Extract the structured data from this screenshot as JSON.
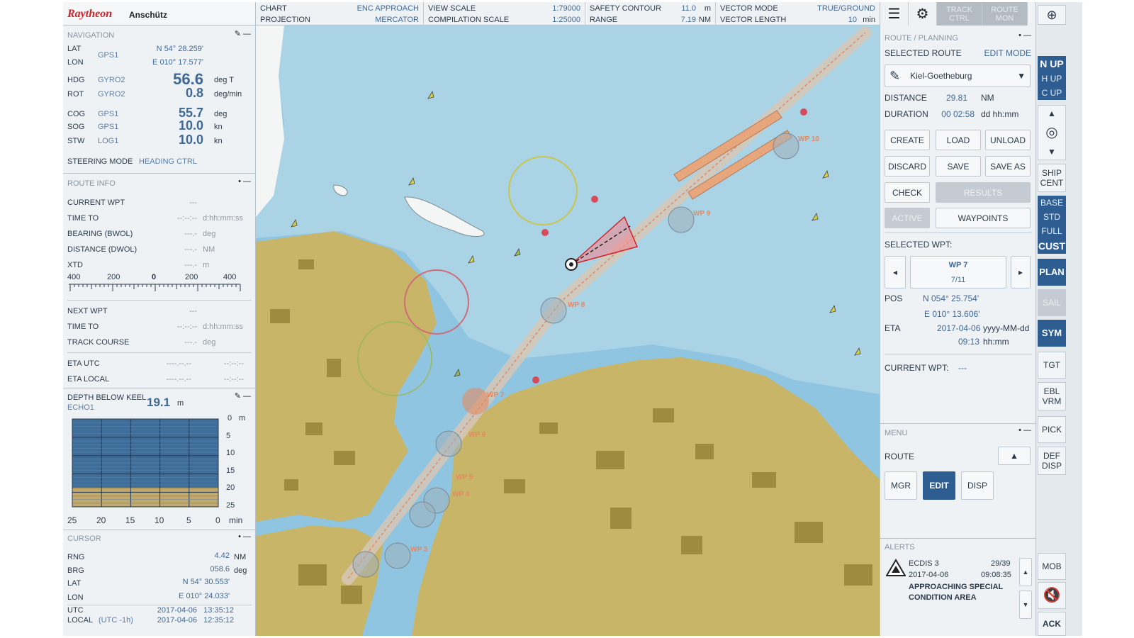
{
  "brand": {
    "name": "Raytheon",
    "sub": "Anschütz"
  },
  "top": {
    "chart_label": "CHART",
    "chart_value": "ENC APPROACH",
    "projection_label": "PROJECTION",
    "projection_value": "MERCATOR",
    "view_scale_label": "VIEW SCALE",
    "view_scale_value": "1:79000",
    "compilation_label": "COMPILATION SCALE",
    "compilation_value": "1:25000",
    "safety_label": "SAFETY CONTOUR",
    "safety_value": "11.0",
    "safety_unit": "m",
    "range_label": "RANGE",
    "range_value": "7.19",
    "range_unit": "NM",
    "vector_mode_label": "VECTOR MODE",
    "vector_mode_value": "TRUE/GROUND",
    "vector_length_label": "VECTOR LENGTH",
    "vector_length_value": "10",
    "vector_length_unit": "min"
  },
  "nav": {
    "title": "NAVIGATION",
    "lat_label": "LAT",
    "lon_label": "LON",
    "pos_src": "GPS1",
    "lat": "N 54° 28.259'",
    "lon": "E 010° 17.577'",
    "hdg_label": "HDG",
    "hdg_src": "GYRO2",
    "hdg": "56.6",
    "hdg_unit": "deg T",
    "rot_label": "ROT",
    "rot_src": "GYRO2",
    "rot": "0.8",
    "rot_unit": "deg/min",
    "cog_label": "COG",
    "cog_src": "GPS1",
    "cog": "55.7",
    "cog_unit": "deg",
    "sog_label": "SOG",
    "sog_src": "GPS1",
    "sog": "10.0",
    "sog_unit": "kn",
    "stw_label": "STW",
    "stw_src": "LOG1",
    "stw": "10.0",
    "stw_unit": "kn",
    "steer_label": "STEERING MODE",
    "steer_value": "HEADING CTRL"
  },
  "route_info": {
    "title": "ROUTE INFO",
    "current_wpt_label": "CURRENT WPT",
    "current_wpt": "---",
    "time_to_label": "TIME TO",
    "time_to": "--:--:--",
    "time_to_unit": "d:hh:mm:ss",
    "bearing_label": "BEARING (BWOL)",
    "bearing": "---.-",
    "bearing_unit": "deg",
    "distance_label": "DISTANCE (DWOL)",
    "distance": "---.-",
    "distance_unit": "NM",
    "xtd_label": "XTD",
    "xtd": "---.-",
    "xtd_unit": "m",
    "scale_ticks": [
      "400",
      "200",
      "0",
      "200",
      "400"
    ],
    "next_wpt_label": "NEXT WPT",
    "next_wpt": "---",
    "time_to2_label": "TIME TO",
    "time_to2": "--:--:--",
    "time_to2_unit": "d:hh:mm:ss",
    "track_label": "TRACK COURSE",
    "track": "---.-",
    "track_unit": "deg",
    "eta_utc_label": "ETA UTC",
    "eta_utc_date": "----.--.--",
    "eta_utc_time": "--:--:--",
    "eta_local_label": "ETA LOCAL",
    "eta_local_date": "----.--.--",
    "eta_local_time": "--:--:--"
  },
  "depth": {
    "title": "DEPTH BELOW KEEL",
    "src": "ECHO1",
    "value": "19.1",
    "unit": "m",
    "y_ticks": [
      "0",
      "5",
      "10",
      "15",
      "20",
      "25"
    ],
    "y_unit": "m",
    "x_ticks": [
      "25",
      "20",
      "15",
      "10",
      "5",
      "0"
    ],
    "x_unit": "min"
  },
  "cursor": {
    "title": "CURSOR",
    "rng_label": "RNG",
    "rng": "4.42",
    "rng_unit": "NM",
    "brg_label": "BRG",
    "brg": "058.6",
    "brg_unit": "deg",
    "lat_label": "LAT",
    "lat": "N 54° 30.553'",
    "lon_label": "LON",
    "lon": "E 010° 24.033'",
    "utc_label": "UTC",
    "utc": "2017-04-06   13:35:12",
    "local_label": "LOCAL",
    "local_offset": "(UTC -1h)",
    "local": "2017-04-06   12:35:12"
  },
  "chart": {
    "waypoints": [
      "WP 10",
      "WP 9",
      "WP 8",
      "WP 7",
      "WP 6",
      "WP 5",
      "WP 4",
      "WP 3"
    ]
  },
  "toolbar": {
    "track_ctrl": "TRACK CTRL",
    "route_mon": "ROUTE MON"
  },
  "route": {
    "title": "ROUTE / PLANNING",
    "selected_label": "SELECTED ROUTE",
    "mode": "EDIT MODE",
    "name": "Kiel-Goetheburg",
    "distance_label": "DISTANCE",
    "distance": "29.81",
    "distance_unit": "NM",
    "duration_label": "DURATION",
    "duration": "00 02:58",
    "duration_unit": "dd hh:mm",
    "btn_create": "CREATE",
    "btn_load": "LOAD",
    "btn_unload": "UNLOAD",
    "btn_discard": "DISCARD",
    "btn_save": "SAVE",
    "btn_save_as": "SAVE AS",
    "btn_check": "CHECK",
    "btn_results": "RESULTS",
    "btn_active": "ACTIVE",
    "btn_waypoints": "WAYPOINTS",
    "selected_wpt_label": "SELECTED WPT:",
    "wpt_name": "WP 7",
    "wpt_index": "7/11",
    "pos_label": "POS",
    "pos_lat": "N 054° 25.754'",
    "pos_lon": "E 010° 13.606'",
    "eta_label": "ETA",
    "eta_date": "2017-04-06",
    "eta_date_fmt": "yyyy-MM-dd",
    "eta_time": "09:13",
    "eta_time_fmt": "hh:mm",
    "current_wpt_label": "CURRENT WPT:",
    "current_wpt": "---"
  },
  "menu": {
    "title": "MENU",
    "route_label": "ROUTE",
    "btn_mgr": "MGR",
    "btn_edit": "EDIT",
    "btn_disp": "DISP"
  },
  "alerts": {
    "title": "ALERTS",
    "source": "ECDIS 3",
    "count": "29/39",
    "date": "2017-04-06",
    "time": "09:08:35",
    "message": "APPROACHING SPECIAL CONDITION AREA"
  },
  "strip": {
    "n_up": "N UP",
    "h_up": "H UP",
    "c_up": "C UP",
    "ship_cent": "SHIP CENT",
    "base": "BASE",
    "std": "STD",
    "full": "FULL",
    "cust": "CUST",
    "plan": "PLAN",
    "sail": "SAIL",
    "sym": "SYM",
    "tgt": "TGT",
    "ebl_vrm": "EBL VRM",
    "pick": "PICK",
    "def_disp": "DEF DISP",
    "mob": "MOB",
    "ack": "ACK"
  },
  "colors": {
    "accent": "#2e5d91",
    "value": "#3e6896",
    "sea": "#aad3e5",
    "land": "#c9b567",
    "route": "#e38a63",
    "alert": "#d0242a"
  }
}
